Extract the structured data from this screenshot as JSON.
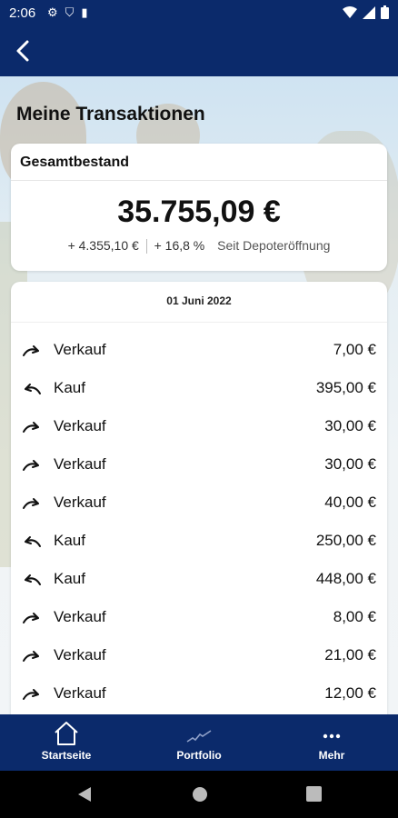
{
  "status": {
    "time": "2:06"
  },
  "page": {
    "title": "Meine Transaktionen"
  },
  "summary": {
    "label": "Gesamtbestand",
    "amount": "35.755,09 €",
    "change_abs": "+ 4.355,10 €",
    "change_pct": "+ 16,8 %",
    "since": "Seit Depoteröffnung"
  },
  "transactions": {
    "date": "01 Juni 2022",
    "rows": [
      {
        "type": "Verkauf",
        "amount": "7,00 €",
        "icon": "sell-arrow-icon"
      },
      {
        "type": "Kauf",
        "amount": "395,00 €",
        "icon": "buy-arrow-icon"
      },
      {
        "type": "Verkauf",
        "amount": "30,00 €",
        "icon": "sell-arrow-icon"
      },
      {
        "type": "Verkauf",
        "amount": "30,00 €",
        "icon": "sell-arrow-icon"
      },
      {
        "type": "Verkauf",
        "amount": "40,00 €",
        "icon": "sell-arrow-icon"
      },
      {
        "type": "Kauf",
        "amount": "250,00 €",
        "icon": "buy-arrow-icon"
      },
      {
        "type": "Kauf",
        "amount": "448,00 €",
        "icon": "buy-arrow-icon"
      },
      {
        "type": "Verkauf",
        "amount": "8,00 €",
        "icon": "sell-arrow-icon"
      },
      {
        "type": "Verkauf",
        "amount": "21,00 €",
        "icon": "sell-arrow-icon"
      },
      {
        "type": "Verkauf",
        "amount": "12,00 €",
        "icon": "sell-arrow-icon"
      }
    ]
  },
  "tabs": [
    {
      "label": "Startseite",
      "icon": "home-icon"
    },
    {
      "label": "Portfolio",
      "icon": "chart-line-icon"
    },
    {
      "label": "Mehr",
      "icon": "more-dots-icon"
    }
  ],
  "colors": {
    "primary": "#0b2a6b"
  }
}
